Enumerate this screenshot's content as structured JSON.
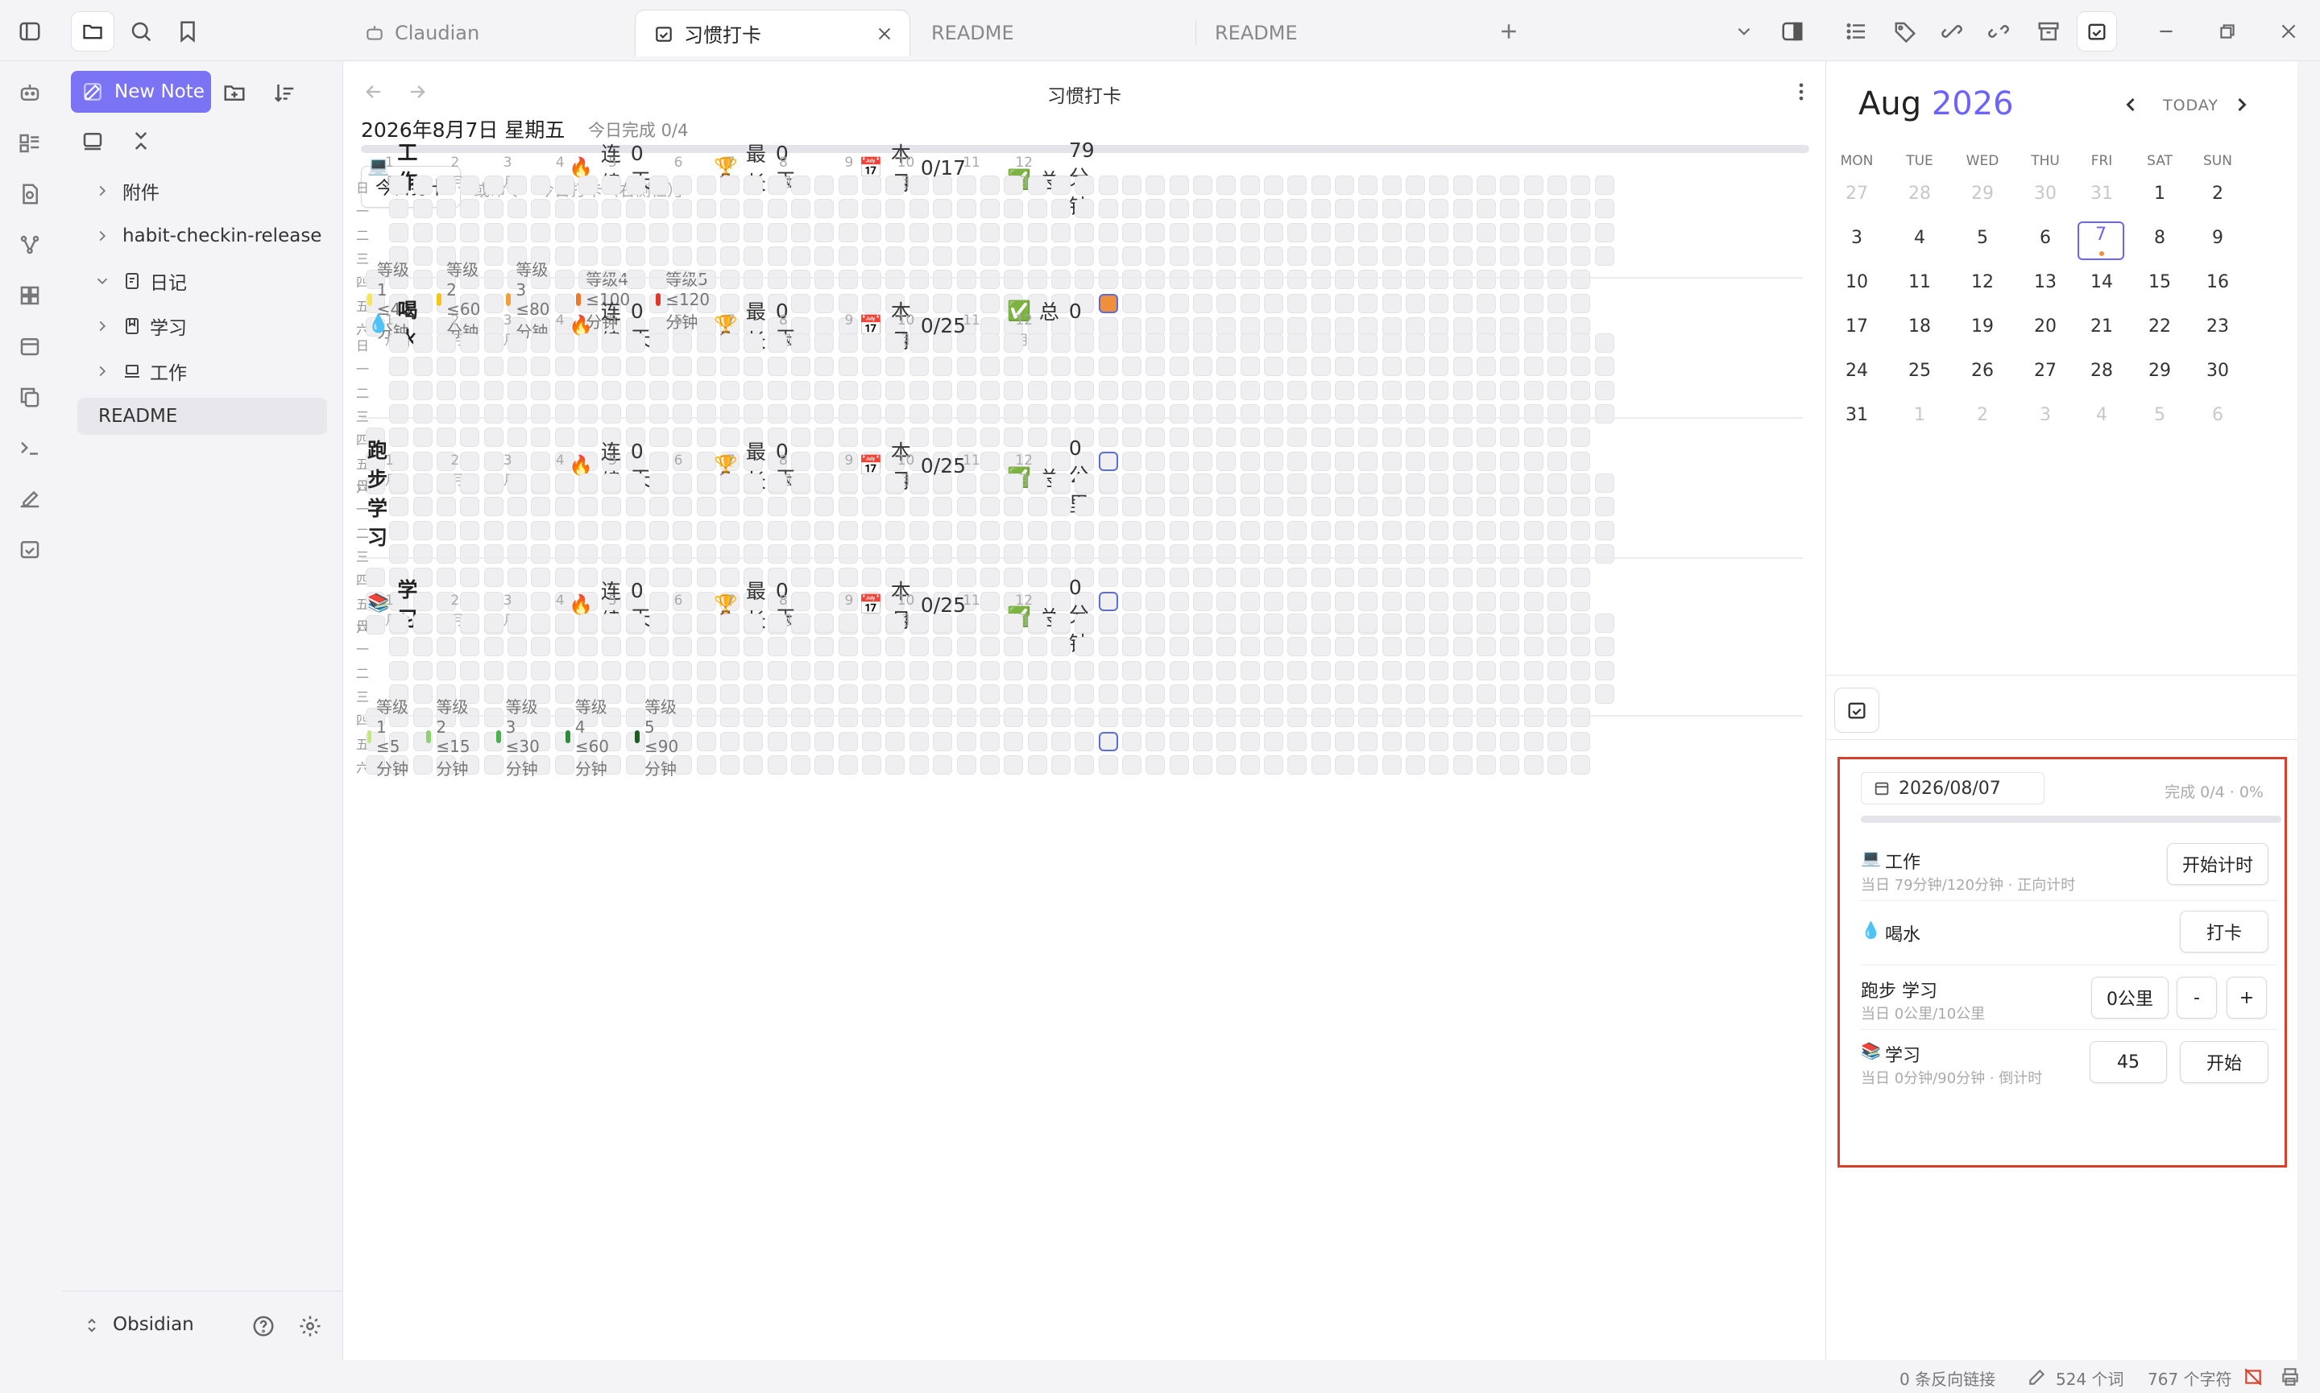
{
  "tabs": [
    {
      "label": "Claudian"
    },
    {
      "label": "习惯打卡"
    },
    {
      "label": "README"
    },
    {
      "label": "README"
    }
  ],
  "file_panel": {
    "new_note": "New Note",
    "items": [
      {
        "label": "附件"
      },
      {
        "label": "habit-checkin-release"
      },
      {
        "label": "日记"
      },
      {
        "label": "学习"
      },
      {
        "label": "工作"
      },
      {
        "label": "README"
      }
    ],
    "vault": "Obsidian"
  },
  "view": {
    "title": "习惯打卡",
    "date_line": "2026年8月7日 星期五",
    "today_done": "今日完成 0/4",
    "checkin_button": "今日打卡",
    "hint": "或命令「今日打卡（右侧栏）」"
  },
  "months": [
    "1月",
    "2月",
    "3月",
    "4月",
    "5月",
    "6月",
    "7月",
    "8月",
    "9月",
    "10月",
    "11月",
    "12月"
  ],
  "weekdays": [
    "日",
    "一",
    "二",
    "三",
    "四",
    "五",
    "六"
  ],
  "habits": [
    {
      "icon": "💻",
      "name": "工作",
      "streak_label": "连续",
      "streak": "0 天",
      "best_label": "最长",
      "best": "0 天",
      "month_label": "本月",
      "month": "0/17",
      "total_label": "总",
      "total": "79分钟"
    },
    {
      "icon": "💧",
      "name": "喝水",
      "streak_label": "连续",
      "streak": "0 天",
      "best_label": "最长",
      "best": "0 天",
      "month_label": "本月",
      "month": "0/25",
      "total_label": "总",
      "total": "0"
    },
    {
      "icon": "",
      "name": "跑步 学习",
      "streak_label": "连续",
      "streak": "0 天",
      "best_label": "最长",
      "best": "0 天",
      "month_label": "本月",
      "month": "0/25",
      "total_label": "总",
      "total": "0公里"
    },
    {
      "icon": "📚",
      "name": "学习",
      "streak_label": "连续",
      "streak": "0 天",
      "best_label": "最长",
      "best": "0 天",
      "month_label": "本月",
      "month": "0/25",
      "total_label": "总",
      "total": "0分钟"
    }
  ],
  "legend_work": [
    "等级1 ≤40分钟",
    "等级2 ≤60分钟",
    "等级3 ≤80分钟",
    "等级4 ≤100分钟",
    "等级5 ≤120分钟"
  ],
  "legend_work_colors": [
    "#f6e55a",
    "#f5c518",
    "#f0a03c",
    "#ec7a2e",
    "#d93a2b"
  ],
  "legend_study": [
    "等级1 ≤5分钟",
    "等级2 ≤15分钟",
    "等级3 ≤30分钟",
    "等级4 ≤60分钟",
    "等级5 ≤90分钟"
  ],
  "legend_study_colors": [
    "#c3e48a",
    "#8fd070",
    "#4caf50",
    "#2e8b3e",
    "#1b5e20"
  ],
  "calendar": {
    "month": "Aug",
    "year": "2026",
    "today": "TODAY",
    "weekdays": [
      "MON",
      "TUE",
      "WED",
      "THU",
      "FRI",
      "SAT",
      "SUN"
    ],
    "weeks": [
      [
        "27",
        "28",
        "29",
        "30",
        "31",
        "1",
        "2"
      ],
      [
        "3",
        "4",
        "5",
        "6",
        "7",
        "8",
        "9"
      ],
      [
        "10",
        "11",
        "12",
        "13",
        "14",
        "15",
        "16"
      ],
      [
        "17",
        "18",
        "19",
        "20",
        "21",
        "22",
        "23"
      ],
      [
        "24",
        "25",
        "26",
        "27",
        "28",
        "29",
        "30"
      ],
      [
        "31",
        "1",
        "2",
        "3",
        "4",
        "5",
        "6"
      ]
    ]
  },
  "panel": {
    "date": "2026/08/07",
    "progress": "完成 0/4 · 0%",
    "rows": [
      {
        "icon": "💻",
        "name": "工作",
        "sub": "当日 79分钟/120分钟 · 正向计时",
        "button": "开始计时"
      },
      {
        "icon": "💧",
        "name": "喝水",
        "sub": "",
        "button": "打卡"
      },
      {
        "icon": "",
        "name": "跑步 学习",
        "sub": "当日 0公里/10公里",
        "value": "0公里",
        "minus": "-",
        "plus": "+"
      },
      {
        "icon": "📚",
        "name": "学习",
        "sub": "当日 0分钟/90分钟 · 倒计时",
        "value": "45",
        "button": "开始"
      }
    ]
  },
  "status": {
    "backlinks": "0 条反向链接",
    "words": "524 个词",
    "chars": "767 个字符"
  },
  "colors": {
    "accent": "#6c63ff",
    "orange": "#f0903c",
    "highlight": "#d9402b"
  }
}
